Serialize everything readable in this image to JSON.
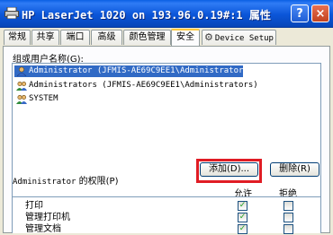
{
  "window": {
    "title": "HP LaserJet 1020 on 193.96.0.19#:1 属性",
    "help_label": "?",
    "close_label": "×"
  },
  "tabs": [
    {
      "label": "常规"
    },
    {
      "label": "共享"
    },
    {
      "label": "端口"
    },
    {
      "label": "高级"
    },
    {
      "label": "颜色管理"
    },
    {
      "label": "安全",
      "active": true
    },
    {
      "label": "Device Setup"
    }
  ],
  "security": {
    "group_label": "组或用户名称(G):",
    "users": [
      {
        "name": "Administrator (JFMIS-AE69C9EE1\\Administrator)",
        "selected": true,
        "icon": "user-icon"
      },
      {
        "name": "Administrators (JFMIS-AE69C9EE1\\Administrators)",
        "selected": false,
        "icon": "group-icon"
      },
      {
        "name": "SYSTEM",
        "selected": false,
        "icon": "group-icon"
      }
    ],
    "add_button": "添加(D)...",
    "remove_button": "删除(R)",
    "perm_label_prefix": "Administrator",
    "perm_label_suffix": " 的权限(P)",
    "allow_header": "允许",
    "deny_header": "拒绝",
    "permissions": [
      {
        "name": "打印",
        "allow": true,
        "deny": false
      },
      {
        "name": "管理打印机",
        "allow": true,
        "deny": false
      },
      {
        "name": "管理文档",
        "allow": true,
        "deny": false
      }
    ]
  }
}
